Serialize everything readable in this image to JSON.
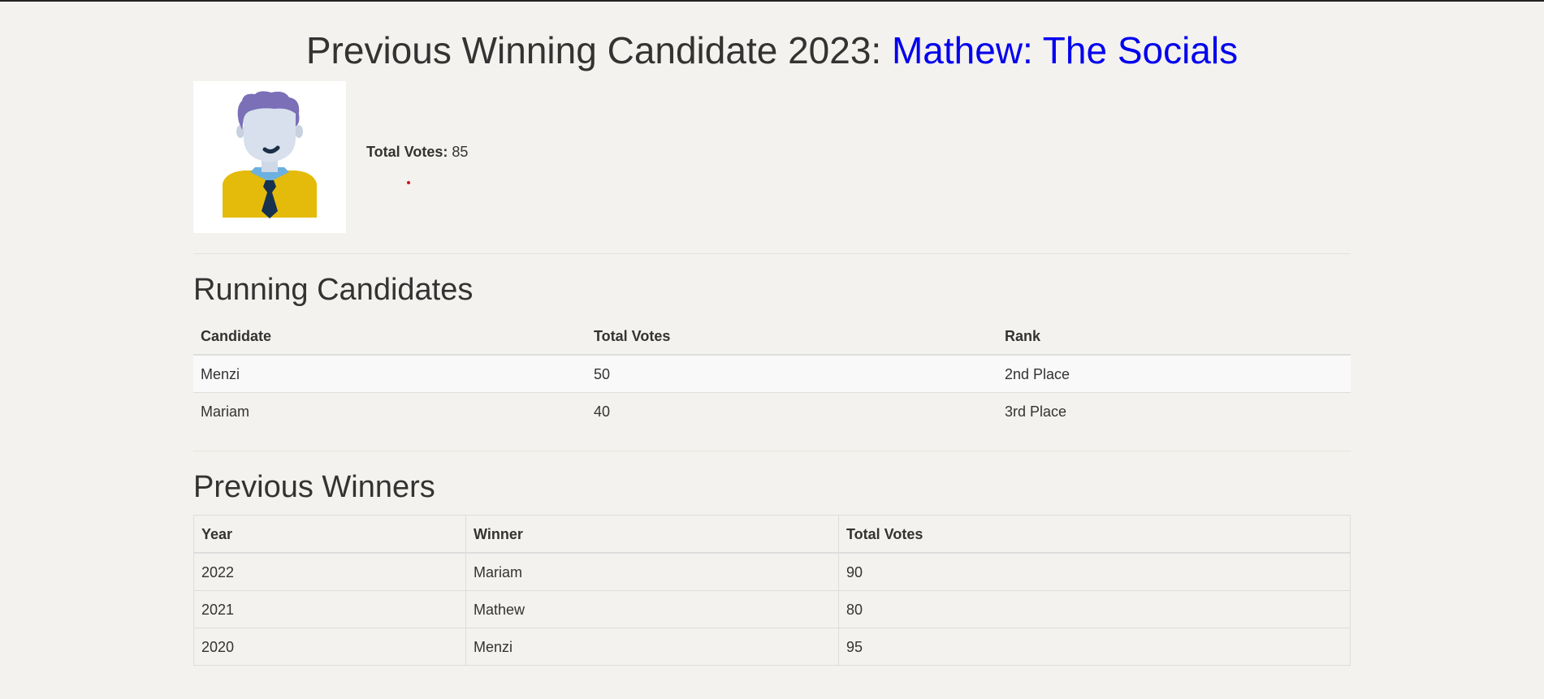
{
  "header": {
    "title_prefix": "Previous Winning Candidate 2023: ",
    "title_winner": "Mathew: The Socials"
  },
  "winner": {
    "total_votes_label": "Total Votes:",
    "total_votes_value": "85",
    "avatar_icon": "person-avatar-icon"
  },
  "running": {
    "heading": "Running Candidates",
    "columns": [
      "Candidate",
      "Total Votes",
      "Rank"
    ],
    "rows": [
      [
        "Menzi",
        "50",
        "2nd Place"
      ],
      [
        "Mariam",
        "40",
        "3rd Place"
      ]
    ]
  },
  "previous": {
    "heading": "Previous Winners",
    "columns": [
      "Year",
      "Winner",
      "Total Votes"
    ],
    "rows": [
      [
        "2022",
        "Mariam",
        "90"
      ],
      [
        "2021",
        "Mathew",
        "80"
      ],
      [
        "2020",
        "Menzi",
        "95"
      ]
    ]
  },
  "colors": {
    "background": "#f4f2ee",
    "link": "#0000ee",
    "text": "#333333",
    "dot": "#d0121b"
  }
}
